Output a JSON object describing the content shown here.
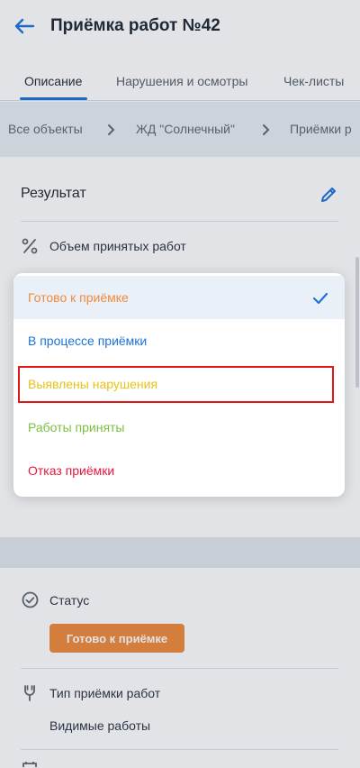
{
  "header": {
    "title": "Приёмка работ №42"
  },
  "tabs": [
    {
      "label": "Описание",
      "active": true
    },
    {
      "label": "Нарушения и осмотры",
      "active": false
    },
    {
      "label": "Чек-листы",
      "active": false
    }
  ],
  "breadcrumbs": [
    "Все объекты",
    "ЖД \"Солнечный\"",
    "Приёмки р"
  ],
  "result": {
    "section_label": "Результат",
    "volume_label": "Объем принятых работ"
  },
  "dropdown": {
    "options": [
      {
        "label": "Готово к приёмке",
        "color": "#f08a3c",
        "selected": true
      },
      {
        "label": "В процессе приёмки",
        "color": "#1d73d7",
        "selected": false
      },
      {
        "label": "Выявлены нарушения",
        "color": "#e8c21a",
        "selected": false
      },
      {
        "label": "Работы приняты",
        "color": "#7bc043",
        "selected": false
      },
      {
        "label": "Отказ приёмки",
        "color": "#e5173f",
        "selected": false
      }
    ]
  },
  "status": {
    "label": "Статус",
    "badge": "Готово к приёмке",
    "badge_color": "#f08a3c"
  },
  "acceptance_type": {
    "label": "Тип приёмки работ",
    "value": "Видимые работы"
  },
  "colors": {
    "accent": "#1d73d7"
  }
}
